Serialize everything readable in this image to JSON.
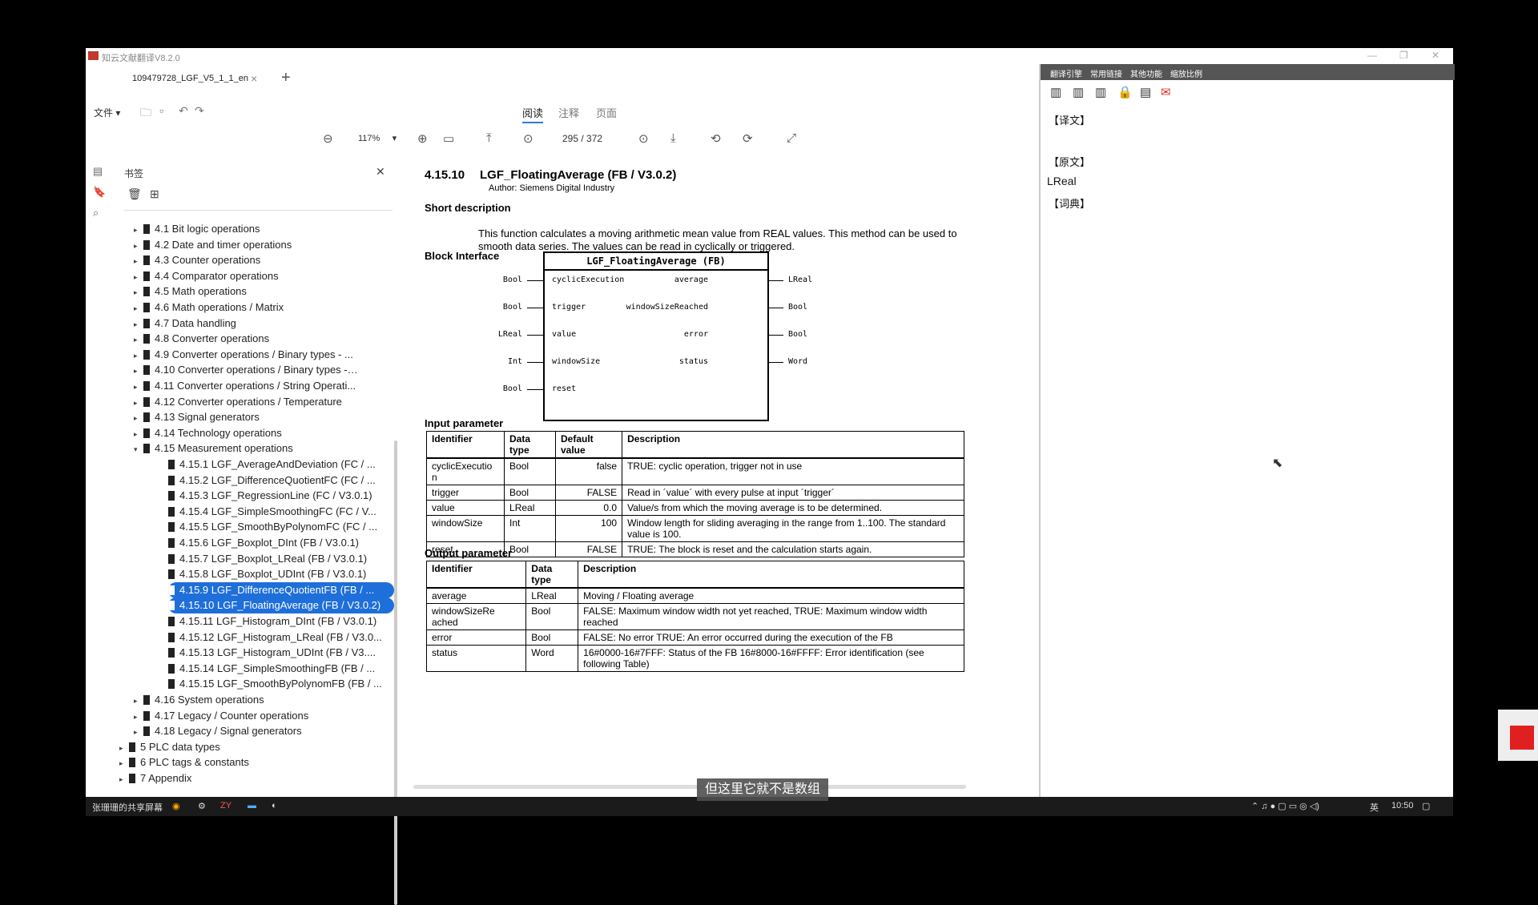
{
  "app": {
    "title": "知云文献翻译V8.2.0"
  },
  "tab": {
    "label": "109479728_LGF_V5_1_1_en",
    "close": "×",
    "add": "+"
  },
  "toolbar": {
    "file_menu": "文件",
    "modes": [
      "阅读",
      "注释",
      "页面"
    ],
    "zoom": "117%",
    "page_current": "295",
    "page_total": "/ 372"
  },
  "sidebar": {
    "title": "书签",
    "items": [
      {
        "label": "4.1 Bit logic operations",
        "level": 1
      },
      {
        "label": "4.2 Date and timer operations",
        "level": 1
      },
      {
        "label": "4.3 Counter operations",
        "level": 1
      },
      {
        "label": "4.4 Comparator operations",
        "level": 1
      },
      {
        "label": "4.5 Math operations",
        "level": 1
      },
      {
        "label": "4.6 Math operations / Matrix",
        "level": 1
      },
      {
        "label": "4.7 Data handling",
        "level": 1
      },
      {
        "label": "4.8 Converter operations",
        "level": 1
      },
      {
        "label": "4.9 Converter operations / Binary types - ...",
        "level": 1
      },
      {
        "label": "4.10 Converter operations / Binary types - ...",
        "level": 1
      },
      {
        "label": "4.11 Converter operations / String Operati...",
        "level": 1
      },
      {
        "label": "4.12 Converter operations / Temperature",
        "level": 1
      },
      {
        "label": "4.13 Signal generators",
        "level": 1
      },
      {
        "label": "4.14 Technology operations",
        "level": 1
      },
      {
        "label": "4.15 Measurement operations",
        "level": 1,
        "expanded": true
      },
      {
        "label": "4.15.1 LGF_AverageAndDeviation (FC / ...",
        "level": 2
      },
      {
        "label": "4.15.2 LGF_DifferenceQuotientFC (FC / ...",
        "level": 2
      },
      {
        "label": "4.15.3 LGF_RegressionLine (FC / V3.0.1)",
        "level": 2
      },
      {
        "label": "4.15.4 LGF_SimpleSmoothingFC (FC / V...",
        "level": 2
      },
      {
        "label": "4.15.5 LGF_SmoothByPolynomFC (FC / ...",
        "level": 2
      },
      {
        "label": "4.15.6 LGF_Boxplot_DInt (FB / V3.0.1)",
        "level": 2
      },
      {
        "label": "4.15.7 LGF_Boxplot_LReal (FB / V3.0.1)",
        "level": 2
      },
      {
        "label": "4.15.8 LGF_Boxplot_UDInt (FB / V3.0.1)",
        "level": 2
      },
      {
        "label": "4.15.9 LGF_DifferenceQuotientFB (FB / ...",
        "level": 2,
        "selected": true
      },
      {
        "label": "4.15.10 LGF_FloatingAverage (FB / V3.0.2)",
        "level": 2,
        "selected": true
      },
      {
        "label": "4.15.11 LGF_Histogram_DInt (FB / V3.0.1)",
        "level": 2
      },
      {
        "label": "4.15.12 LGF_Histogram_LReal (FB / V3.0...",
        "level": 2
      },
      {
        "label": "4.15.13 LGF_Histogram_UDInt (FB / V3....",
        "level": 2
      },
      {
        "label": "4.15.14 LGF_SimpleSmoothingFB (FB / ...",
        "level": 2
      },
      {
        "label": "4.15.15 LGF_SmoothByPolynomFB (FB / ...",
        "level": 2
      },
      {
        "label": "4.16 System operations",
        "level": 1
      },
      {
        "label": "4.17 Legacy / Counter operations",
        "level": 1
      },
      {
        "label": "4.18 Legacy / Signal generators",
        "level": 1
      },
      {
        "label": "5 PLC data types",
        "level": 0
      },
      {
        "label": "6 PLC tags & constants",
        "level": 0
      },
      {
        "label": "7 Appendix",
        "level": 0
      }
    ]
  },
  "doc": {
    "section_num": "4.15.10",
    "section_title": "LGF_FloatingAverage (FB / V3.0.2)",
    "author": "Author: Siemens Digital Industry",
    "short_desc_heading": "Short description",
    "short_desc": "This function calculates a moving arithmetic mean value from REAL values. This method can be used to smooth data series. The values can be read in cyclically or triggered.",
    "block_heading": "Block Interface",
    "block": {
      "title": "LGF_FloatingAverage (FB)",
      "inputs": [
        {
          "type": "Bool",
          "name": "cyclicExecution"
        },
        {
          "type": "Bool",
          "name": "trigger"
        },
        {
          "type": "LReal",
          "name": "value"
        },
        {
          "type": "Int",
          "name": "windowSize"
        },
        {
          "type": "Bool",
          "name": "reset"
        }
      ],
      "outputs": [
        {
          "type": "LReal",
          "name": "average"
        },
        {
          "type": "Bool",
          "name": "windowSizeReached"
        },
        {
          "type": "Bool",
          "name": "error"
        },
        {
          "type": "Word",
          "name": "status"
        }
      ]
    },
    "input_heading": "Input parameter",
    "input_headers": [
      "Identifier",
      "Data type",
      "Default value",
      "Description"
    ],
    "input_rows": [
      [
        "cyclicExecutio n",
        "Bool",
        "false",
        "TRUE: cyclic operation, trigger not in use"
      ],
      [
        "trigger",
        "Bool",
        "FALSE",
        "Read in ´value´ with every pulse at input ´trigger´"
      ],
      [
        "value",
        "LReal",
        "0.0",
        "Value/s from which the moving average is to be determined."
      ],
      [
        "windowSize",
        "Int",
        "100",
        "Window length for sliding averaging in the range from 1..100. The standard value is 100."
      ],
      [
        "reset",
        "Bool",
        "FALSE",
        "TRUE: The block is reset and the calculation starts again."
      ]
    ],
    "output_heading": "Output parameter",
    "output_headers": [
      "Identifier",
      "Data type",
      "Description"
    ],
    "output_rows": [
      [
        "average",
        "LReal",
        "Moving / Floating average"
      ],
      [
        "windowSizeRe ached",
        "Bool",
        "FALSE: Maximum window width not yet reached, TRUE: Maximum window width reached"
      ],
      [
        "error",
        "Bool",
        "FALSE: No error TRUE: An error occurred during the execution of the FB"
      ],
      [
        "status",
        "Word",
        "16#0000-16#7FFF: Status of the FB 16#8000-16#FFFF: Error identification (see following Table)"
      ]
    ]
  },
  "right_panel": {
    "menus": [
      "翻译引擎",
      "常用链接",
      "其他功能",
      "缩放比例"
    ],
    "translation_label": "【译文】",
    "original_label": "【原文】",
    "original_text": "LReal",
    "dictionary_label": "【词典】"
  },
  "taskbar": {
    "share_label": "张珊珊的共享屏幕",
    "ime": "英",
    "time": "10:50"
  },
  "subtitle": "但这里它就不是数组"
}
